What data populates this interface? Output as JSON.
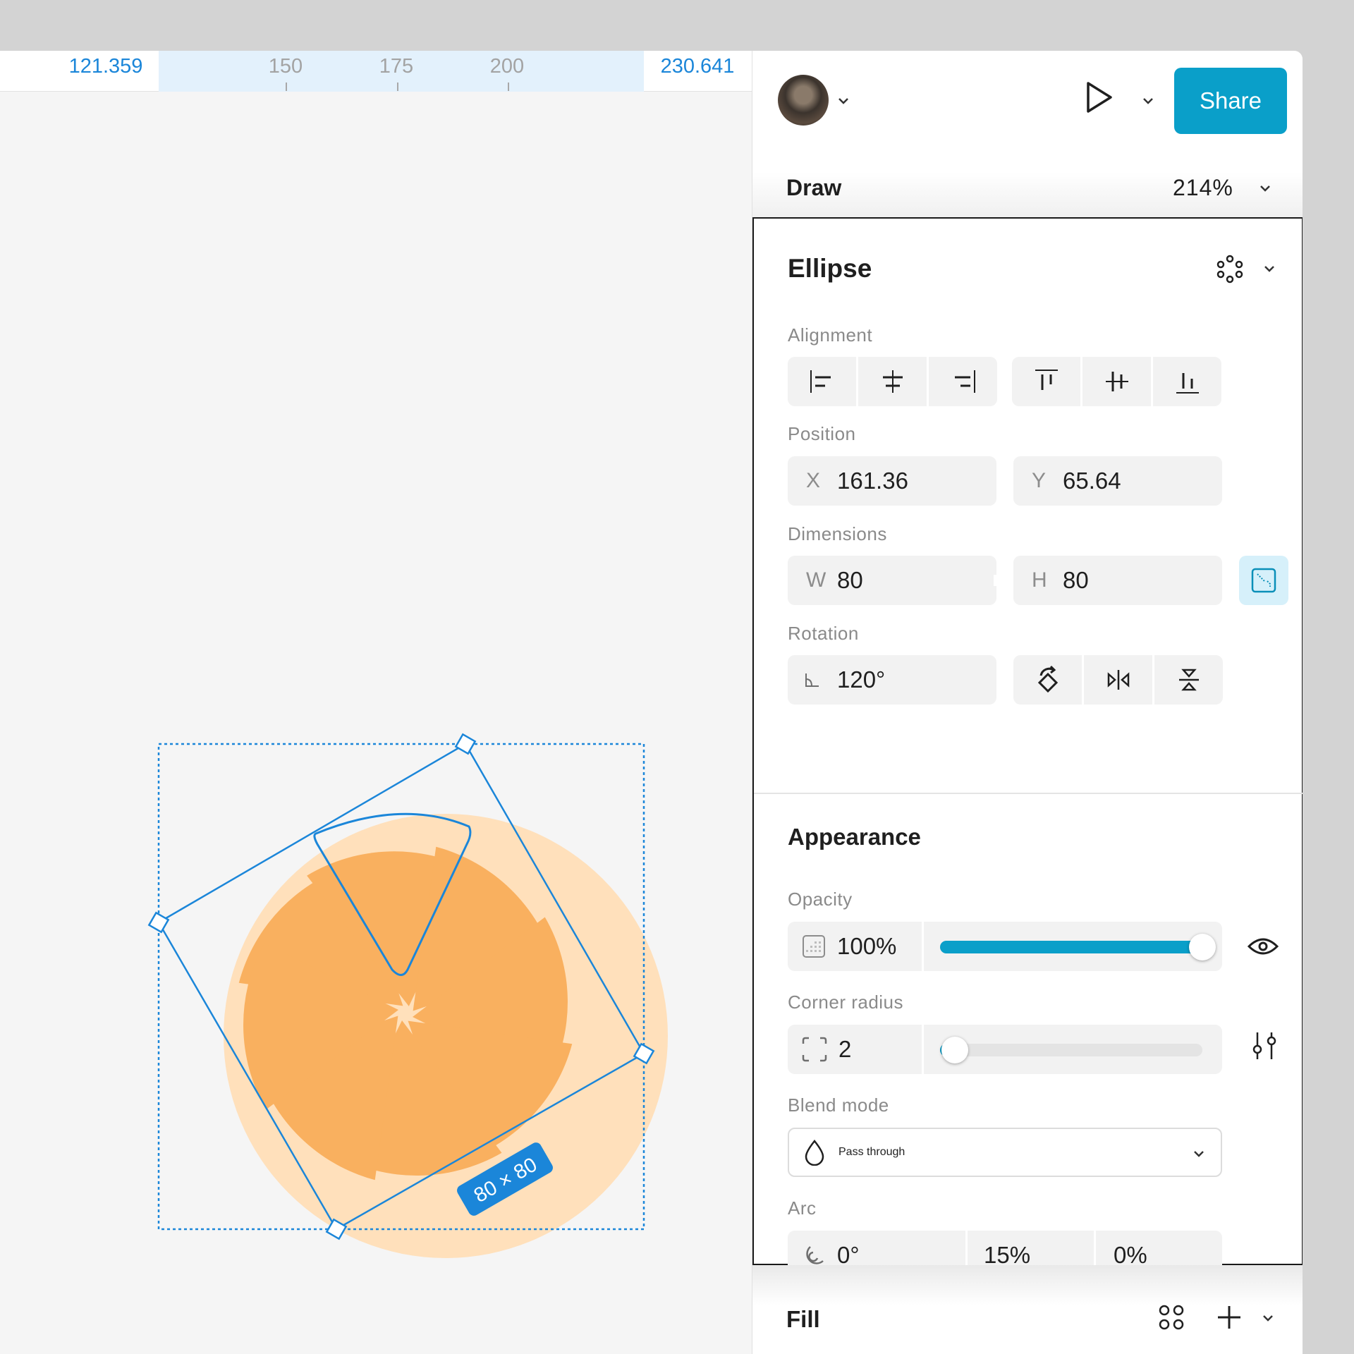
{
  "ruler": {
    "start_value": "121.359",
    "end_value": "230.641",
    "ticks": [
      "150",
      "175",
      "200"
    ]
  },
  "canvas": {
    "size_badge": "80 × 80",
    "shape": "orange-slice"
  },
  "topbar": {
    "share_label": "Share",
    "icons": [
      "avatar",
      "chevron-down-icon",
      "play-icon",
      "chevron-down-icon"
    ]
  },
  "drawbar": {
    "mode": "Draw",
    "zoom": "214%"
  },
  "ellipse": {
    "title": "Ellipse",
    "alignment_label": "Alignment",
    "position_label": "Position",
    "x_prefix": "X",
    "x_value": "161.36",
    "y_prefix": "Y",
    "y_value": "65.64",
    "dimensions_label": "Dimensions",
    "w_prefix": "W",
    "w_value": "80",
    "h_prefix": "H",
    "h_value": "80",
    "rotation_label": "Rotation",
    "rotation_value": "120°"
  },
  "appearance": {
    "title": "Appearance",
    "opacity_label": "Opacity",
    "opacity_value": "100%",
    "opacity_fraction": 1.0,
    "corner_label": "Corner radius",
    "corner_value": "2",
    "corner_fraction": 0.03,
    "blend_label": "Blend mode",
    "blend_value": "Pass through",
    "arc_label": "Arc",
    "arc_start": "0°",
    "arc_sweep": "15%",
    "arc_ratio": "0%"
  },
  "fill": {
    "title": "Fill"
  },
  "colors": {
    "accent": "#0a9fc9",
    "selection": "#1b86d9",
    "orange": "#f9b05f",
    "orange_light": "#ffe0bb"
  }
}
